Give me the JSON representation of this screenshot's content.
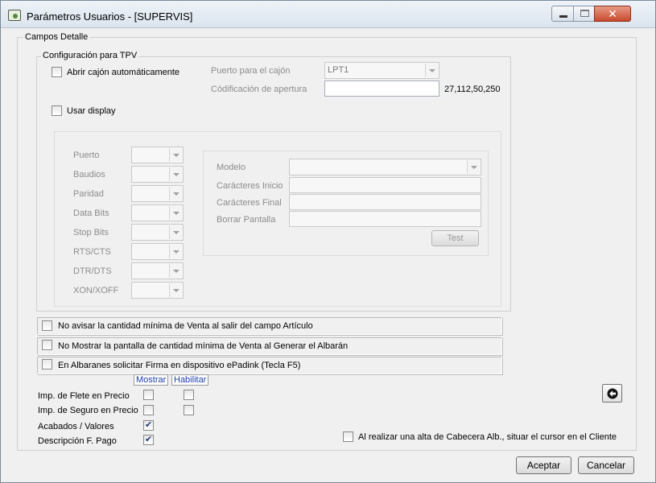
{
  "window": {
    "title": "Parámetros Usuarios - [SUPERVIS]",
    "buttons": {
      "minimize": "minimize-icon",
      "maximize": "maximize-icon",
      "close": "close-icon"
    }
  },
  "campos_detalle": {
    "legend": "Campos Detalle",
    "config_tpv": {
      "legend": "Configuración para TPV",
      "abrir_cajon": {
        "label": "Abrir cajón automáticamente",
        "checked": false
      },
      "puerto_cajon": {
        "label": "Puerto para el cajón",
        "value": "LPT1"
      },
      "codificacion": {
        "label": "Códificación de apertura",
        "value": "",
        "hint": "27,112,50,250"
      },
      "usar_display": {
        "label": "Usar display",
        "checked": false
      },
      "serial": {
        "puerto": "Puerto",
        "baudios": "Baudios",
        "paridad": "Paridad",
        "data_bits": "Data Bits",
        "stop_bits": "Stop Bits",
        "rts_cts": "RTS/CTS",
        "dtr_dts": "DTR/DTS",
        "xon_xoff": "XON/XOFF"
      },
      "display": {
        "modelo": "Modelo",
        "caracteres_inicio": "Carácteres Inicio",
        "caracteres_final": "Carácteres Final",
        "borrar_pantalla": "Borrar Pantalla",
        "test_button": "Test"
      }
    },
    "options": [
      {
        "label": "No avisar la cantidad mínima de Venta al salir del campo Artículo",
        "checked": false
      },
      {
        "label": "No Mostrar la pantalla de cantidad mínima de Venta al Generar el Albarán",
        "checked": false
      },
      {
        "label": "En Albaranes solicitar Firma en dispositivo ePadink (Tecla F5)",
        "checked": false
      }
    ],
    "grid": {
      "col_mostrar": "Mostrar",
      "col_habilitar": "Habilitar",
      "rows": [
        {
          "label": "Imp. de Flete en Precio",
          "mostrar": false,
          "habilitar": false
        },
        {
          "label": "Imp. de Seguro en Precio",
          "mostrar": false,
          "habilitar": false
        },
        {
          "label": "Acabados / Valores",
          "mostrar": true
        },
        {
          "label": "Descripción F. Pago",
          "mostrar": true
        }
      ]
    },
    "cursor_cliente": {
      "label": "Al realizar una alta de Cabecera Alb., situar el cursor en el Cliente",
      "checked": false
    },
    "back_icon": "arrow-left-icon"
  },
  "footer": {
    "aceptar": "Aceptar",
    "cancelar": "Cancelar"
  }
}
